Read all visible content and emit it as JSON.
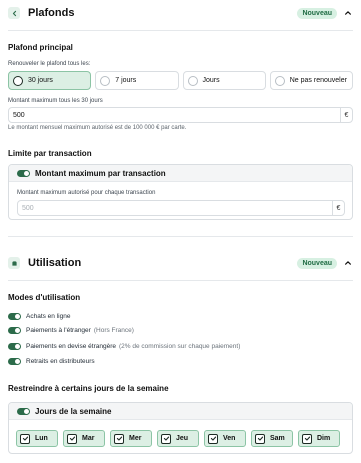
{
  "plafonds": {
    "title": "Plafonds",
    "badge": "Nouveau",
    "icon": "chevron-left-icon",
    "principal": {
      "heading": "Plafond principal",
      "renew_label": "Renouveler le plafond tous les:",
      "options": [
        {
          "label": "30 jours",
          "selected": true
        },
        {
          "label": "7 jours",
          "selected": false
        },
        {
          "label": "Jours",
          "selected": false
        },
        {
          "label": "Ne pas renouveler",
          "selected": false
        }
      ],
      "amount_label": "Montant maximum tous les 30 jours",
      "amount_value": "500",
      "currency": "€",
      "hint": "Le montant mensuel maximum autorisé est de 100 000 € par carte."
    },
    "transaction": {
      "heading": "Limite par transaction",
      "card_title": "Montant maximum par transaction",
      "enabled": true,
      "field_label": "Montant maximum autorisé pour chaque transaction",
      "placeholder": "500",
      "currency": "€"
    }
  },
  "utilisation": {
    "title": "Utilisation",
    "badge": "Nouveau",
    "icon": "wallet-icon",
    "modes_heading": "Modes d'utilisation",
    "modes": [
      {
        "label": "Achats en ligne",
        "sub": "",
        "enabled": true
      },
      {
        "label": "Paiements à l'étranger",
        "sub": "(Hors France)",
        "enabled": true
      },
      {
        "label": "Paiements en devise étrangère",
        "sub": "(2% de commission sur chaque paiement)",
        "enabled": true
      },
      {
        "label": "Retraits en distributeurs",
        "sub": "",
        "enabled": true
      }
    ],
    "days_heading": "Restreindre à certains jours de la semaine",
    "days_card_title": "Jours de la semaine",
    "days": [
      {
        "label": "Lun",
        "checked": true
      },
      {
        "label": "Mar",
        "checked": true
      },
      {
        "label": "Mer",
        "checked": true
      },
      {
        "label": "Jeu",
        "checked": true
      },
      {
        "label": "Ven",
        "checked": true
      },
      {
        "label": "Sam",
        "checked": true
      },
      {
        "label": "Dim",
        "checked": true
      }
    ]
  },
  "colors": {
    "accent": "#2c6b4a",
    "selected_bg": "#dcefe4",
    "badge_bg": "#d7f0e2"
  }
}
